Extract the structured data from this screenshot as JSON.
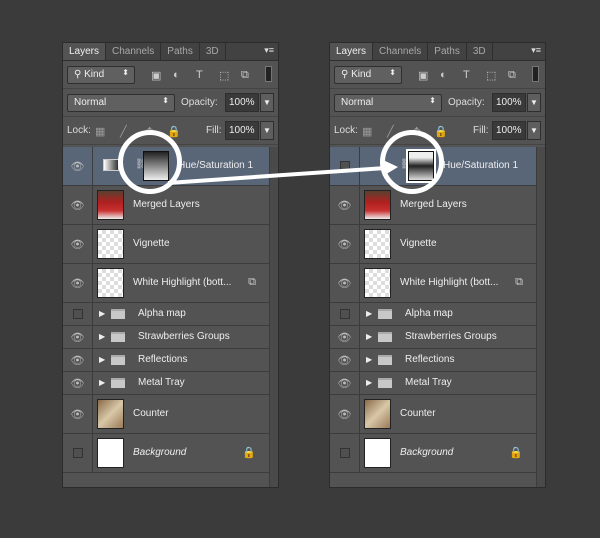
{
  "panels": [
    {
      "tabs": [
        "Layers",
        "Channels",
        "Paths",
        "3D"
      ],
      "filter": "Kind",
      "blend_mode": "Normal",
      "opacity_label": "Opacity:",
      "opacity": "100%",
      "lock_label": "Lock:",
      "fill_label": "Fill:",
      "fill": "100%",
      "layers": [
        {
          "name": "Hue/Saturation 1",
          "visible": true,
          "type": "adjustment",
          "selected": true,
          "mask_highlight": "mask"
        },
        {
          "name": "Merged Layers",
          "visible": true,
          "type": "photo-strawberries"
        },
        {
          "name": "Vignette",
          "visible": true,
          "type": "transparent"
        },
        {
          "name": "White Highlight (bott...",
          "visible": true,
          "type": "transparent",
          "badge": "smart-object-icon"
        },
        {
          "name": "Alpha map",
          "visible": false,
          "type": "group"
        },
        {
          "name": "Strawberries Groups",
          "visible": true,
          "type": "group"
        },
        {
          "name": "Reflections",
          "visible": true,
          "type": "group"
        },
        {
          "name": "Metal Tray",
          "visible": true,
          "type": "group"
        },
        {
          "name": "Counter",
          "visible": true,
          "type": "photo-counter"
        },
        {
          "name": "Background",
          "visible": false,
          "type": "white",
          "locked": true,
          "italic": true
        }
      ]
    },
    {
      "tabs": [
        "Layers",
        "Channels",
        "Paths",
        "3D"
      ],
      "filter": "Kind",
      "blend_mode": "Normal",
      "opacity_label": "Opacity:",
      "opacity": "100%",
      "lock_label": "Lock:",
      "fill_label": "Fill:",
      "fill": "100%",
      "layers": [
        {
          "name": "Hue/Saturation 1",
          "visible": false,
          "type": "adjustment",
          "selected": true,
          "mask_highlight": "inverted-mask"
        },
        {
          "name": "Merged Layers",
          "visible": true,
          "type": "photo-strawberries"
        },
        {
          "name": "Vignette",
          "visible": true,
          "type": "transparent"
        },
        {
          "name": "White Highlight (bott...",
          "visible": true,
          "type": "transparent",
          "badge": "smart-object-icon"
        },
        {
          "name": "Alpha map",
          "visible": false,
          "type": "group"
        },
        {
          "name": "Strawberries Groups",
          "visible": true,
          "type": "group"
        },
        {
          "name": "Reflections",
          "visible": true,
          "type": "group"
        },
        {
          "name": "Metal Tray",
          "visible": true,
          "type": "group"
        },
        {
          "name": "Counter",
          "visible": true,
          "type": "photo-counter"
        },
        {
          "name": "Background",
          "visible": false,
          "type": "white",
          "locked": true,
          "italic": true
        }
      ]
    }
  ],
  "colors": {
    "selected_row": "#596678",
    "panel": "#535353",
    "annotation": "#ffffff"
  }
}
